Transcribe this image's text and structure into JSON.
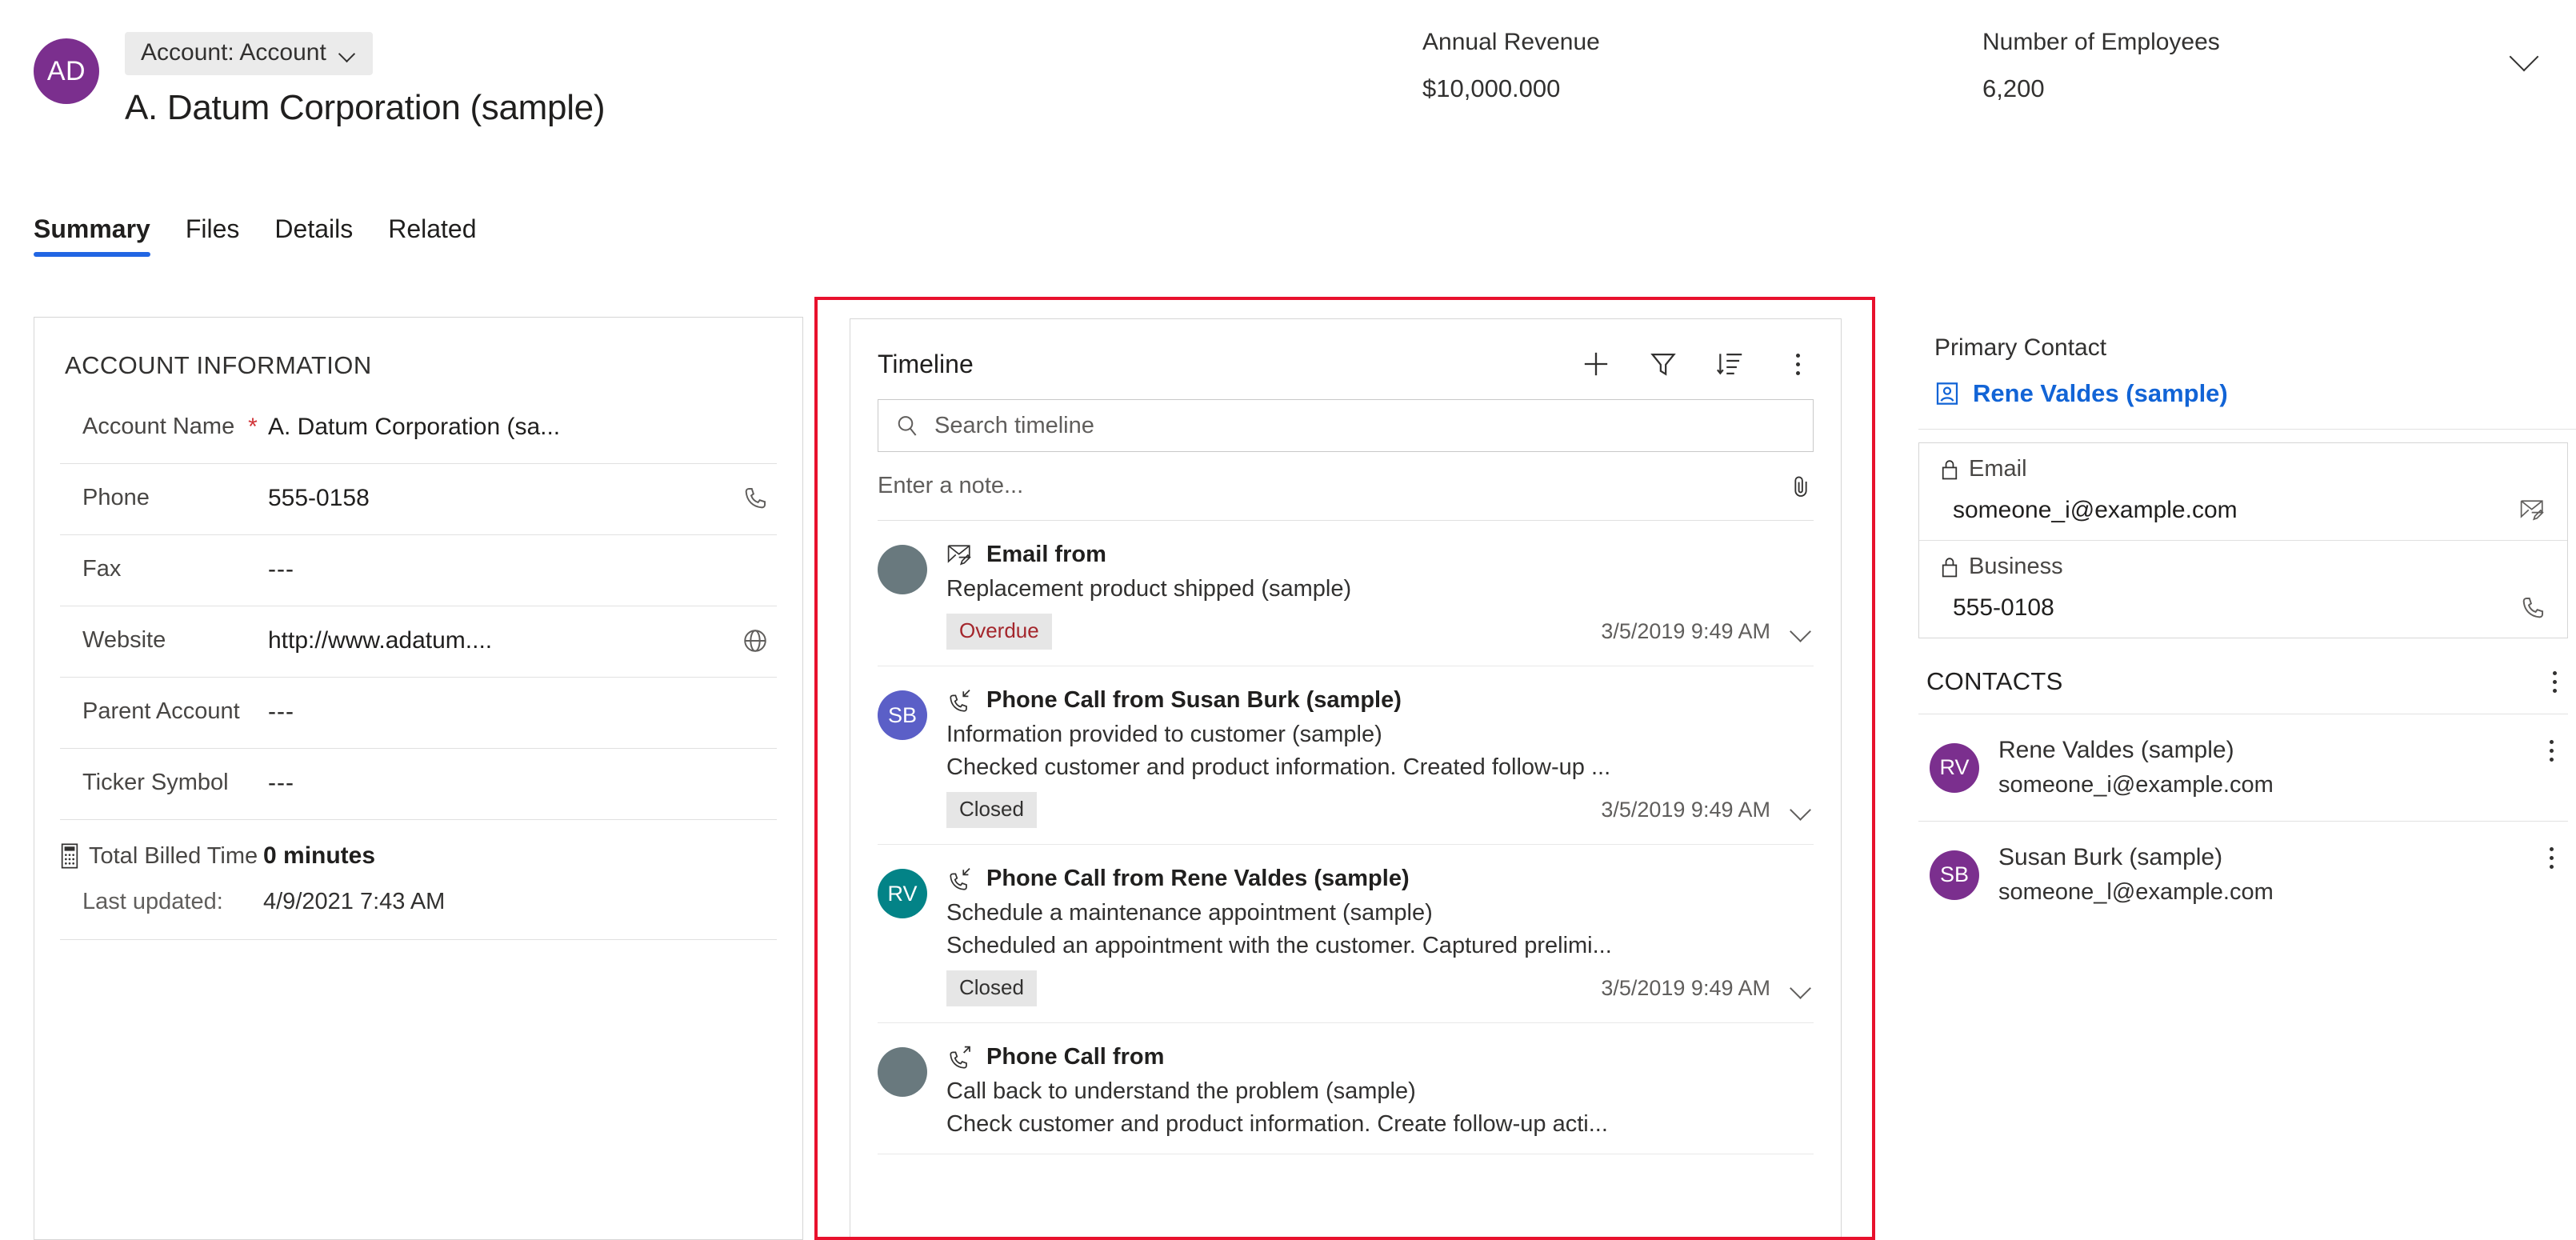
{
  "header": {
    "avatar_initials": "AD",
    "avatar_color": "#7B2F8E",
    "entity_pill": "Account: Account",
    "record_title": "A. Datum Corporation (sample)",
    "stats": [
      {
        "label": "Annual Revenue",
        "value": "$10,000.000"
      },
      {
        "label": "Number of Employees",
        "value": "6,200"
      }
    ],
    "collapse_icon": "chevron-down-icon"
  },
  "tabs": [
    {
      "label": "Summary",
      "active": true
    },
    {
      "label": "Files",
      "active": false
    },
    {
      "label": "Details",
      "active": false
    },
    {
      "label": "Related",
      "active": false
    }
  ],
  "account_information": {
    "section_title": "ACCOUNT INFORMATION",
    "fields": [
      {
        "label": "Account Name",
        "required": "*",
        "value": "A. Datum Corporation (sa...",
        "icon": ""
      },
      {
        "label": "Phone",
        "required": "",
        "value": "555-0158",
        "icon": "phone-icon"
      },
      {
        "label": "Fax",
        "required": "",
        "value": "---",
        "icon": ""
      },
      {
        "label": "Website",
        "required": "",
        "value": "http://www.adatum....",
        "icon": "globe-icon"
      },
      {
        "label": "Parent Account",
        "required": "",
        "value": "---",
        "icon": ""
      },
      {
        "label": "Ticker Symbol",
        "required": "",
        "value": "---",
        "icon": ""
      }
    ],
    "total_billed_time": {
      "label": "Total Billed Time",
      "value": "0 minutes",
      "icon": "calculator-icon"
    },
    "last_updated": {
      "label": "Last updated:",
      "value": "4/9/2021 7:43 AM"
    }
  },
  "timeline": {
    "title": "Timeline",
    "actions": [
      {
        "name": "add-icon",
        "label": "Create a timeline record"
      },
      {
        "name": "filter-icon",
        "label": "Filter timeline"
      },
      {
        "name": "sort-icon",
        "label": "Sort timeline"
      },
      {
        "name": "more-commands-icon",
        "label": "More commands"
      }
    ],
    "search_placeholder": "Search timeline",
    "note_placeholder": "Enter a note...",
    "attach_icon": "paperclip-icon",
    "items": [
      {
        "avatar_initials": "",
        "avatar_color": "#69797E",
        "type_icon": "email-icon",
        "title": "Email from",
        "subject": "Replacement product shipped (sample)",
        "description": "",
        "badge": "Overdue",
        "badge_style": "overdue",
        "date": "3/5/2019 9:49 AM"
      },
      {
        "avatar_initials": "SB",
        "avatar_color": "#5B5FC7",
        "type_icon": "phone-incoming-icon",
        "title": "Phone Call from Susan Burk (sample)",
        "subject": "Information provided to customer (sample)",
        "description": "Checked customer and product information. Created follow-up ...",
        "badge": "Closed",
        "badge_style": "normal",
        "date": "3/5/2019 9:49 AM"
      },
      {
        "avatar_initials": "RV",
        "avatar_color": "#038387",
        "type_icon": "phone-incoming-icon",
        "title": "Phone Call from Rene Valdes (sample)",
        "subject": "Schedule a maintenance appointment (sample)",
        "description": "Scheduled an appointment with the customer. Captured prelimi...",
        "badge": "Closed",
        "badge_style": "normal",
        "date": "3/5/2019 9:49 AM"
      },
      {
        "avatar_initials": "",
        "avatar_color": "#69797E",
        "type_icon": "phone-outgoing-icon",
        "title": "Phone Call from",
        "subject": "Call back to understand the problem (sample)",
        "description": "Check customer and product information. Create follow-up acti...",
        "badge": "",
        "badge_style": "normal",
        "date": ""
      }
    ]
  },
  "right_panel": {
    "primary_contact": {
      "label": "Primary Contact",
      "name": "Rene Valdes (sample)",
      "name_color": "#1264D6",
      "icon": "contact-card-icon",
      "fields": [
        {
          "label": "Email",
          "lock_icon": "lock-icon",
          "value": "someone_i@example.com",
          "action_icon": "email-icon"
        },
        {
          "label": "Business",
          "lock_icon": "lock-icon",
          "value": "555-0108",
          "action_icon": "phone-icon"
        }
      ]
    },
    "contacts": {
      "title": "CONTACTS",
      "more_icon": "more-commands-icon",
      "items": [
        {
          "initials": "RV",
          "avatar_color": "#7B2F8E",
          "name": "Rene Valdes (sample)",
          "email": "someone_i@example.com",
          "more_icon": "more-commands-icon"
        },
        {
          "initials": "SB",
          "avatar_color": "#7B2F8E",
          "name": "Susan Burk (sample)",
          "email": "someone_l@example.com",
          "more_icon": "more-commands-icon"
        }
      ]
    }
  },
  "annotation": {
    "highlight_color": "#E8112D"
  }
}
